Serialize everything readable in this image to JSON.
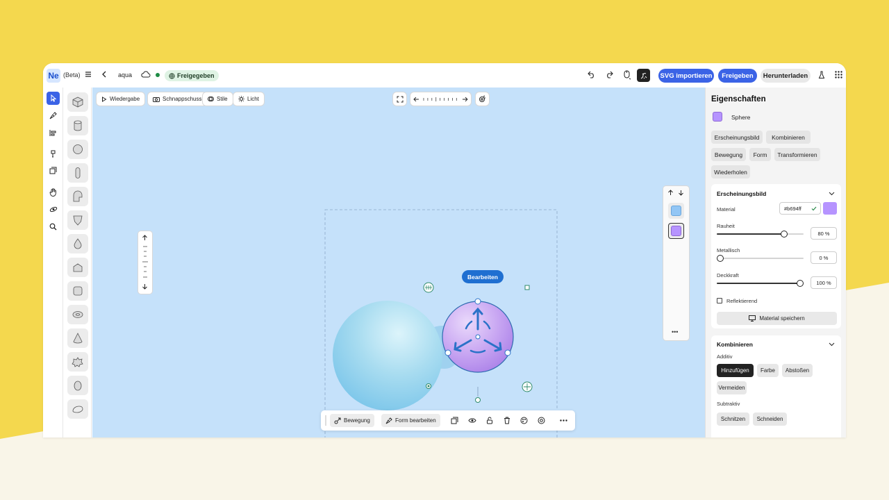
{
  "topbar": {
    "logo": "Ne",
    "beta": "(Beta)",
    "project_name": "aqua",
    "share_status": "Freigegeben",
    "import_svg": "SVG importieren",
    "share": "Freigeben",
    "download": "Herunterladen"
  },
  "canvas": {
    "playback": "Wiedergabe",
    "snapshot": "Schnappschuss",
    "styles": "Stile",
    "light": "Licht",
    "edit_label": "Bearbeiten"
  },
  "bottombar": {
    "motion": "Bewegung",
    "edit_shape": "Form bearbeiten"
  },
  "properties": {
    "title": "Eigenschaften",
    "object_name": "Sphere",
    "object_color": "#b694ff",
    "tabs": [
      "Erscheinungsbild",
      "Kombinieren",
      "Bewegung",
      "Form",
      "Transformieren",
      "Wiederholen"
    ],
    "appearance": {
      "title": "Erscheinungsbild",
      "material_label": "Material",
      "material_value": "#b694ff",
      "roughness_label": "Rauheit",
      "roughness_value": "80 %",
      "roughness": 0.8,
      "metallic_label": "Metallisch",
      "metallic_value": "0 %",
      "metallic": 0,
      "opacity_label": "Deckkraft",
      "opacity_value": "100 %",
      "opacity": 1,
      "reflective_label": "Reflektierend",
      "save_material": "Material speichern"
    },
    "combine": {
      "title": "Kombinieren",
      "additive_label": "Additiv",
      "additive_options": [
        "Hinzufügen",
        "Farbe",
        "Abstoßen",
        "Vermeiden"
      ],
      "subtractive_label": "Subtraktiv",
      "subtractive_options": [
        "Schnitzen",
        "Schneiden"
      ]
    }
  },
  "colors": {
    "accent": "#3b63e6",
    "canvas": "#c5e1fa",
    "background_yellow": "#f4d84e",
    "background_cream": "#f9f5e8",
    "swatch_blue": "#92c6f5",
    "swatch_purple": "#b694ff"
  }
}
